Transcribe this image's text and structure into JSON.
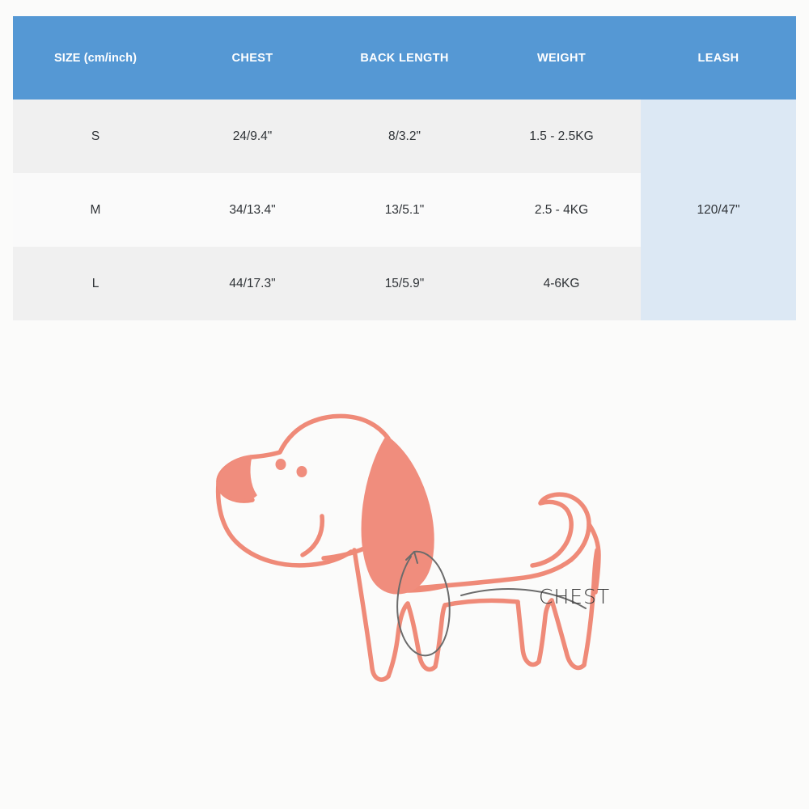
{
  "table": {
    "headers": [
      "SIZE (cm/inch)",
      "CHEST",
      "BACK LENGTH",
      "WEIGHT",
      "LEASH"
    ],
    "rows": [
      {
        "size": "S",
        "chest": "24/9.4\"",
        "back_length": "8/3.2\"",
        "weight": "1.5 - 2.5KG"
      },
      {
        "size": "M",
        "chest": "34/13.4\"",
        "back_length": "13/5.1\"",
        "weight": "2.5 - 4KG"
      },
      {
        "size": "L",
        "chest": "44/17.3\"",
        "back_length": "15/5.9\"",
        "weight": "4-6KG"
      }
    ],
    "leash_value": "120/47\"",
    "colors": {
      "header_bg": "#5598d4",
      "header_text": "#ffffff",
      "row_odd_bg": "#f0f0f0",
      "row_even_bg": "#fafafa",
      "leash_bg": "#dce8f4",
      "body_text": "#2f3337"
    }
  },
  "illustration": {
    "label": "CHEST",
    "subject": "dog-side-view",
    "colors": {
      "outline": "#ef8a78",
      "ear_fill": "#f08d7d",
      "measure_line": "#6b6b6b",
      "label_text": "#3c3c3c"
    }
  },
  "page": {
    "background": "#fbfbfa"
  }
}
